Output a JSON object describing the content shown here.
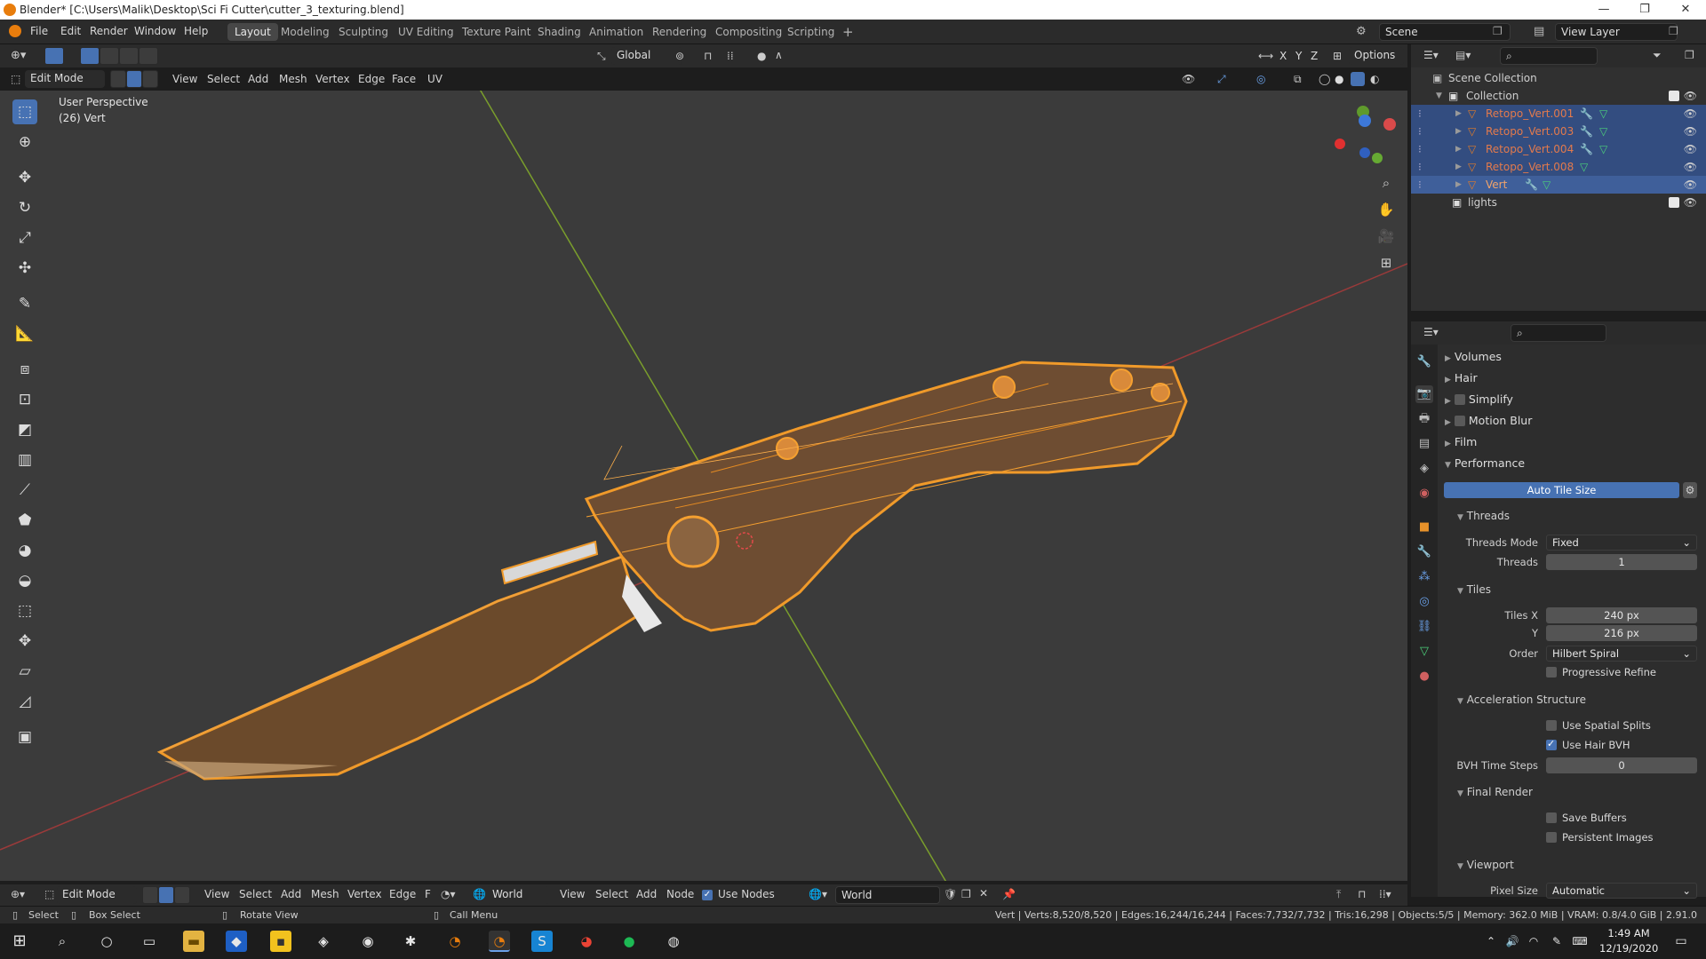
{
  "window": {
    "title": "Blender* [C:\\Users\\Malik\\Desktop\\Sci Fi Cutter\\cutter_3_texturing.blend]",
    "controls": [
      "—",
      "❐",
      "✕"
    ]
  },
  "topbar": {
    "menus": [
      "File",
      "Edit",
      "Render",
      "Window",
      "Help"
    ],
    "workspaces": [
      "Layout",
      "Modeling",
      "Sculpting",
      "UV Editing",
      "Texture Paint",
      "Shading",
      "Animation",
      "Rendering",
      "Compositing",
      "Scripting"
    ],
    "active_workspace": "Layout",
    "add_tab": "+",
    "scene": "Scene",
    "view_layer": "View Layer"
  },
  "viewport_header": {
    "mode": "Edit Mode",
    "menus": [
      "View",
      "Select",
      "Add",
      "Mesh",
      "Vertex",
      "Edge",
      "Face",
      "UV"
    ],
    "orientation": "Global",
    "axes": [
      "X",
      "Y",
      "Z"
    ],
    "options": "Options"
  },
  "viewport": {
    "perspective": "User Perspective",
    "object_info": "(26) Vert"
  },
  "outliner": {
    "root": "Scene Collection",
    "collection": "Collection",
    "objects": [
      "Retopo_Vert.001",
      "Retopo_Vert.003",
      "Retopo_Vert.004",
      "Retopo_Vert.008",
      "Vert"
    ],
    "lights": "lights"
  },
  "properties": {
    "sections": {
      "volumes": "Volumes",
      "hair": "Hair",
      "simplify": "Simplify",
      "motion_blur": "Motion Blur",
      "film": "Film",
      "performance": "Performance"
    },
    "auto_tile_size": "Auto Tile Size",
    "threads": {
      "header": "Threads",
      "mode_label": "Threads Mode",
      "mode_value": "Fixed",
      "count_label": "Threads",
      "count_value": "1"
    },
    "tiles": {
      "header": "Tiles",
      "x_label": "Tiles X",
      "x_value": "240 px",
      "y_label": "Y",
      "y_value": "216 px",
      "order_label": "Order",
      "order_value": "Hilbert Spiral",
      "progressive": "Progressive Refine"
    },
    "acceleration": {
      "header": "Acceleration Structure",
      "spatial": "Use Spatial Splits",
      "hair_bvh": "Use Hair BVH",
      "bvh_label": "BVH Time Steps",
      "bvh_value": "0"
    },
    "final_render": {
      "header": "Final Render",
      "save_buffers": "Save Buffers",
      "persistent": "Persistent Images"
    },
    "viewport_section": {
      "header": "Viewport",
      "pixel_label": "Pixel Size",
      "pixel_value": "Automatic"
    }
  },
  "bottom_header": {
    "mode": "Edit Mode",
    "menus": [
      "View",
      "Select",
      "Add",
      "Mesh",
      "Vertex",
      "Edge",
      "F"
    ],
    "world_type": "World",
    "menus2": [
      "View",
      "Select",
      "Add",
      "Node"
    ],
    "use_nodes": "Use Nodes",
    "world_name": "World"
  },
  "statusbar": {
    "select": "Select",
    "box_select": "Box Select",
    "rotate": "Rotate View",
    "call_menu": "Call Menu",
    "stats": "Vert | Verts:8,520/8,520 | Edges:16,244/16,244 | Faces:7,732/7,732 | Tris:16,298 | Objects:5/5 | Memory: 362.0 MiB | VRAM: 0.8/4.0 GiB | 2.91.0"
  },
  "taskbar": {
    "time": "1:49 AM",
    "date": "12/19/2020"
  },
  "colors": {
    "accent": "#4772b3",
    "mesh_orange": "#e8922a",
    "viewport_bg": "#3b3b3b"
  }
}
